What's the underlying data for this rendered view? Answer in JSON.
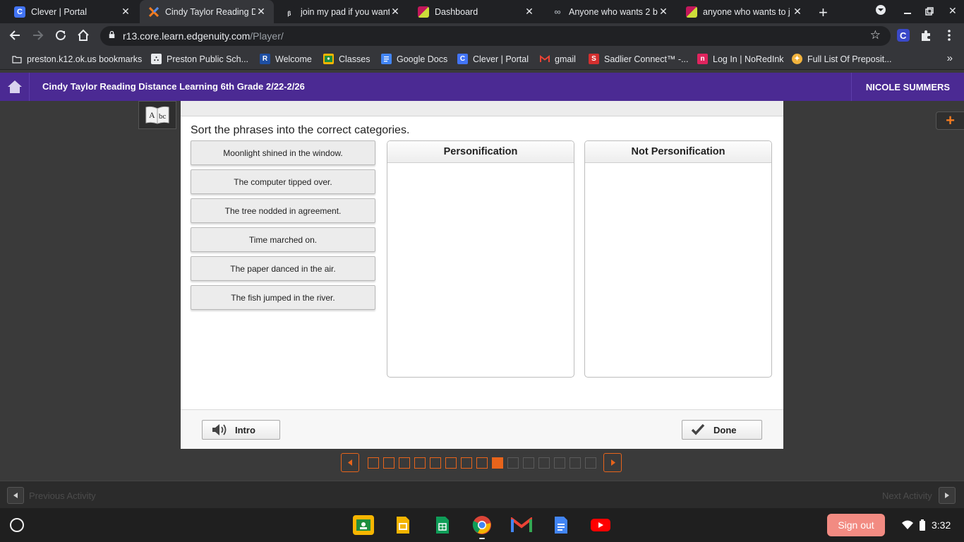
{
  "browser": {
    "tabs": [
      {
        "title": "Clever | Portal",
        "icon": "clever-icon",
        "color": "#4274f6"
      },
      {
        "title": "Cindy Taylor Reading D",
        "icon": "edgenuity-icon",
        "color": "#f47b20"
      },
      {
        "title": "join my pad if you want",
        "icon": "brainly-icon",
        "color": "#202124"
      },
      {
        "title": "Dashboard",
        "icon": "pear-deck-icon",
        "color": "#b5246d"
      },
      {
        "title": "Anyone who wants 2 b",
        "icon": "link-icon",
        "color": "#9aa0a6"
      },
      {
        "title": "anyone who wants to j",
        "icon": "pear-deck-icon",
        "color": "#b5246d"
      }
    ],
    "url_host": "r13.core.learn.edgenuity.com",
    "url_path": "/Player/",
    "bookmarks": [
      {
        "label": "preston.k12.ok.us bookmarks",
        "icon": "folder-icon"
      },
      {
        "label": "Preston Public Sch...",
        "icon": "school-icon"
      },
      {
        "label": "Welcome",
        "icon": "welcome-icon"
      },
      {
        "label": "Classes",
        "icon": "classroom-icon"
      },
      {
        "label": "Google Docs",
        "icon": "docs-icon"
      },
      {
        "label": "Clever | Portal",
        "icon": "clever-icon"
      },
      {
        "label": "gmail",
        "icon": "gmail-icon"
      },
      {
        "label": "Sadlier Connect™ -...",
        "icon": "sadlier-icon"
      },
      {
        "label": "Log In | NoRedInk",
        "icon": "noredink-icon"
      },
      {
        "label": "Full List Of Preposit...",
        "icon": "preposition-site-icon"
      }
    ]
  },
  "header": {
    "course": "Cindy Taylor Reading Distance Learning 6th Grade 2/22-2/26",
    "user": "NICOLE SUMMERS"
  },
  "activity": {
    "prompt": "Sort the phrases into the correct categories.",
    "phrases": [
      "Moonlight shined in the window.",
      "The computer tipped over.",
      "The tree nodded in agreement.",
      "Time marched on.",
      "The paper danced in the air.",
      "The fish jumped in the river."
    ],
    "categories": [
      "Personification",
      "Not Personification"
    ],
    "intro_label": "Intro",
    "done_label": "Done"
  },
  "pager": {
    "total": 15,
    "completed": 8,
    "current": 9
  },
  "nav": {
    "previous": "Previous Activity",
    "next": "Next Activity"
  },
  "system": {
    "sign_out": "Sign out",
    "time": "3:32"
  },
  "colors": {
    "header": "#4b2a93",
    "accent": "#e8641b"
  }
}
